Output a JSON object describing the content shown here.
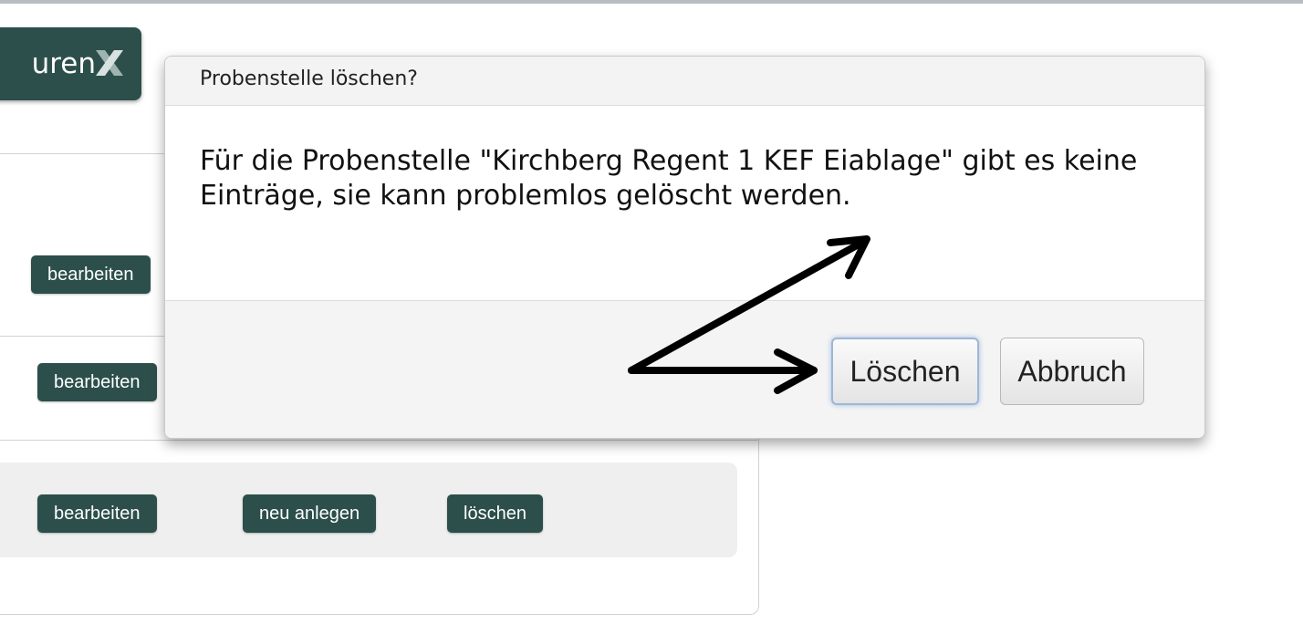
{
  "logo": {
    "text": "uren"
  },
  "background_rows": [
    {
      "buttons": [
        "bearbeiten"
      ]
    },
    {
      "buttons": [
        "bearbeiten"
      ]
    },
    {
      "buttons": [
        "bearbeiten",
        "neu anlegen",
        "löschen"
      ]
    }
  ],
  "dialog": {
    "title": "Probenstelle löschen?",
    "message": "Für die Probenstelle \"Kirchberg Regent 1 KEF Eiablage\" gibt es keine Einträge, sie kann problemlos gelöscht werden.",
    "confirm_label": "Löschen",
    "cancel_label": "Abbruch"
  },
  "colors": {
    "brand": "#2c4f4b",
    "focus": "#9fb6d6"
  }
}
